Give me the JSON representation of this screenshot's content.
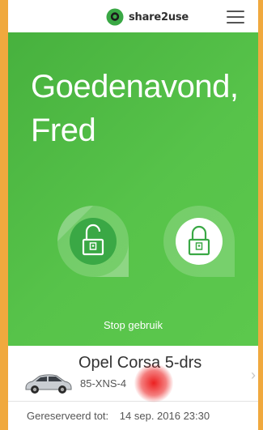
{
  "header": {
    "brand": "share2use",
    "logo_icon": "share2use-logo-icon",
    "menu_icon": "hamburger-menu-icon",
    "brand_color": "#3aa845"
  },
  "main": {
    "greeting_line1": "Goedenavond,",
    "greeting_line2": "Fred",
    "unlock_icon": "unlock-icon",
    "lock_icon": "lock-icon",
    "stop_label": "Stop gebruik",
    "background_color": "#52be46"
  },
  "car": {
    "name": "Opel Corsa 5-drs",
    "plate": "85-XNS-4",
    "icon": "car-icon",
    "chevron_icon": "chevron-right-icon"
  },
  "reservation": {
    "label": "Gereserveerd tot:",
    "value": "14 sep. 2016 23:30"
  },
  "outer_color": "#f0a93e"
}
